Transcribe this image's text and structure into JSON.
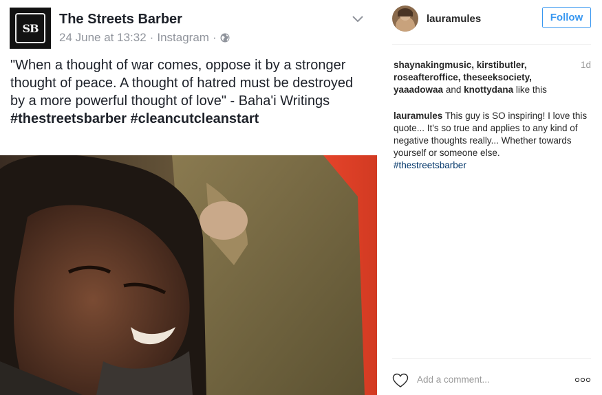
{
  "post": {
    "page_name": "The Streets Barber",
    "logo_text": "SB",
    "date": "24 June at 13:32",
    "separator": "·",
    "source": "Instagram",
    "caption_quote": "\"When a thought of war comes, oppose it by a stronger thought of peace. A thought of hatred must be destroyed by a more powerful thought of love\" - Baha'i Writings",
    "caption_hashtags": "#thestreetsbarber #cleancutcleanstart",
    "icons": {
      "menu": "chevron-down-icon",
      "privacy": "globe-icon"
    }
  },
  "instagram": {
    "username": "lauramules",
    "follow_label": "Follow",
    "likes": {
      "users_line1": "shaynakingmusic, kirstibutler,",
      "users_line2": "roseafteroffice, theseeksociety,",
      "user_a": "yaaadowaa",
      "and_word": "and",
      "user_b": "knottydana",
      "suffix": "like this"
    },
    "time_ago": "1d",
    "comment": {
      "user": "lauramules",
      "text": "This guy is SO inspiring! I love this quote... It's so true and applies to any kind of negative thoughts really... Whether towards yourself or someone else.",
      "hashtag": "#thestreetsbarber"
    },
    "add_comment_placeholder": "Add a comment...",
    "icons": {
      "like": "heart-icon",
      "more": "more-options-icon"
    },
    "colors": {
      "accent": "#3897f0",
      "hashtag": "#003569",
      "muted": "#999999"
    }
  }
}
